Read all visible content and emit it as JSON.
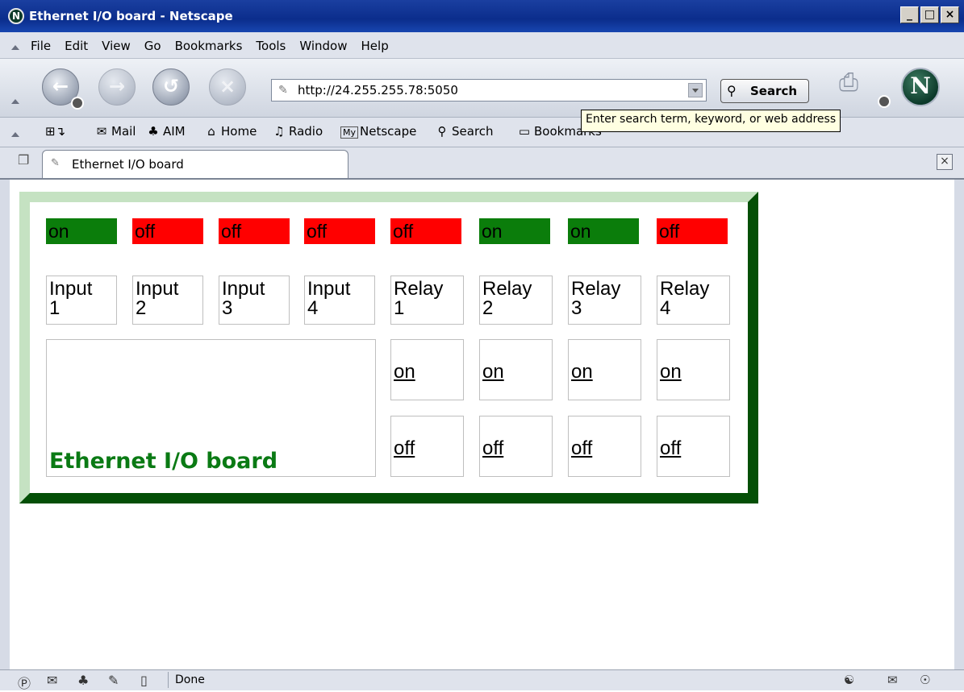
{
  "window": {
    "title": "Ethernet I/O board - Netscape",
    "app_icon": "N",
    "buttons": [
      "_",
      "□",
      "×"
    ]
  },
  "menu": [
    "File",
    "Edit",
    "View",
    "Go",
    "Bookmarks",
    "Tools",
    "Window",
    "Help"
  ],
  "nav": {
    "url": "http://24.255.255.78:5050",
    "search_label": "Search",
    "logo": "N",
    "icons": [
      "back-arrow-icon",
      "forward-arrow-icon",
      "reload-icon",
      "stop-icon",
      "print-icon"
    ]
  },
  "tooltip": "Enter search term, keyword, or web address",
  "personal_toolbar": {
    "items": [
      {
        "label": "Mail",
        "icon": "✉"
      },
      {
        "label": "AIM",
        "icon": "♣"
      },
      {
        "label": "Home",
        "icon": "⌂"
      },
      {
        "label": "Radio",
        "icon": "♫"
      },
      {
        "label": "Netscape",
        "icon": "My"
      },
      {
        "label": "Search",
        "icon": "⚲"
      },
      {
        "label": "Bookmarks",
        "icon": "▭"
      }
    ]
  },
  "tab": {
    "label": "Ethernet I/O board"
  },
  "board": {
    "statuses": [
      {
        "text": "on",
        "color": "#0b7d0b"
      },
      {
        "text": "off",
        "color": "#ff0000"
      },
      {
        "text": "off",
        "color": "#ff0000"
      },
      {
        "text": "off",
        "color": "#ff0000"
      },
      {
        "text": "off",
        "color": "#ff0000"
      },
      {
        "text": "on",
        "color": "#0b7d0b"
      },
      {
        "text": "on",
        "color": "#0b7d0b"
      },
      {
        "text": "off",
        "color": "#ff0000"
      }
    ],
    "labels": [
      [
        "Input",
        "1"
      ],
      [
        "Input",
        "2"
      ],
      [
        "Input",
        "3"
      ],
      [
        "Input",
        "4"
      ],
      [
        "Relay",
        "1"
      ],
      [
        "Relay",
        "2"
      ],
      [
        "Relay",
        "3"
      ],
      [
        "Relay",
        "4"
      ]
    ],
    "relay_on_label": "on",
    "relay_off_label": "off",
    "brand": "Ethernet I/O board",
    "brand_color": "#0a7a14"
  },
  "statusbar": {
    "text": "Done"
  }
}
